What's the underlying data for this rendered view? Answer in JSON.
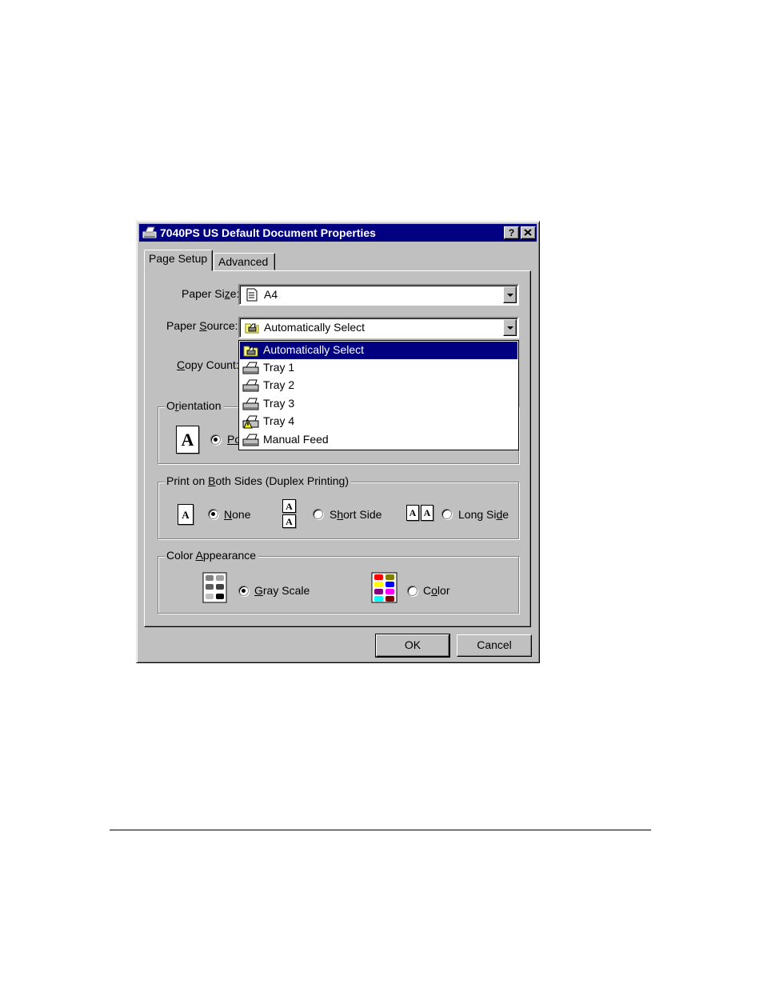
{
  "window": {
    "title": "7040PS US Default Document Properties",
    "help_glyph": "?",
    "close_glyph": "✕"
  },
  "tabs": [
    {
      "label": "Page Setup",
      "selected": true
    },
    {
      "label": "Advanced",
      "selected": false
    }
  ],
  "paper_size": {
    "label": "Paper Si",
    "label_u": "z",
    "label_rest": "e:",
    "value": "A4",
    "icon": "document-icon"
  },
  "paper_source": {
    "label": "Paper ",
    "label_u": "S",
    "label_rest": "ource:",
    "value": "Automatically Select",
    "icon": "folder-printer-icon"
  },
  "copy_count": {
    "label_u": "C",
    "label_rest": "opy Count:"
  },
  "paper_source_options": [
    {
      "label": "Automatically Select",
      "icon": "folder-printer-icon",
      "selected": true
    },
    {
      "label": "Tray 1",
      "icon": "printer-icon",
      "selected": false
    },
    {
      "label": "Tray 2",
      "icon": "printer-icon",
      "selected": false
    },
    {
      "label": "Tray 3",
      "icon": "printer-icon",
      "selected": false
    },
    {
      "label": "Tray 4",
      "icon": "printer-warning-icon",
      "selected": false
    },
    {
      "label": "Manual Feed",
      "icon": "printer-icon",
      "selected": false
    }
  ],
  "orientation": {
    "title": "O",
    "title_u": "r",
    "title_rest": "ientation",
    "portrait_partial": "Po",
    "icon_letter": "A"
  },
  "duplex": {
    "title": "Print on ",
    "title_u": "B",
    "title_rest": "oth Sides (Duplex Printing)",
    "options": [
      {
        "label_u": "N",
        "label_rest": "one",
        "checked": true
      },
      {
        "label": "S",
        "label_u": "h",
        "label_rest": "ort Side",
        "checked": false
      },
      {
        "label": "Long Si",
        "label_u": "d",
        "label_rest": "e",
        "checked": false
      }
    ],
    "icon_letter": "A"
  },
  "color_appearance": {
    "title": "Color ",
    "title_u": "A",
    "title_rest": "ppearance",
    "options": [
      {
        "label_u": "G",
        "label_rest": "ray Scale",
        "checked": true
      },
      {
        "label": "C",
        "label_u": "o",
        "label_rest": "lor",
        "checked": false
      }
    ],
    "colors": {
      "gray": [
        "#808080",
        "#a0a0a0",
        "#606060",
        "#404040",
        "#c0c0c0",
        "#000000"
      ],
      "color": [
        "#ff0000",
        "#808000",
        "#ffff00",
        "#0000ff",
        "#800080",
        "#ff00ff",
        "#00ffff",
        "#800000"
      ]
    }
  },
  "buttons": {
    "ok": "OK",
    "cancel": "Cancel"
  },
  "colors": {
    "titlebar": "#000080",
    "face": "#c0c0c0",
    "selection": "#000080"
  }
}
